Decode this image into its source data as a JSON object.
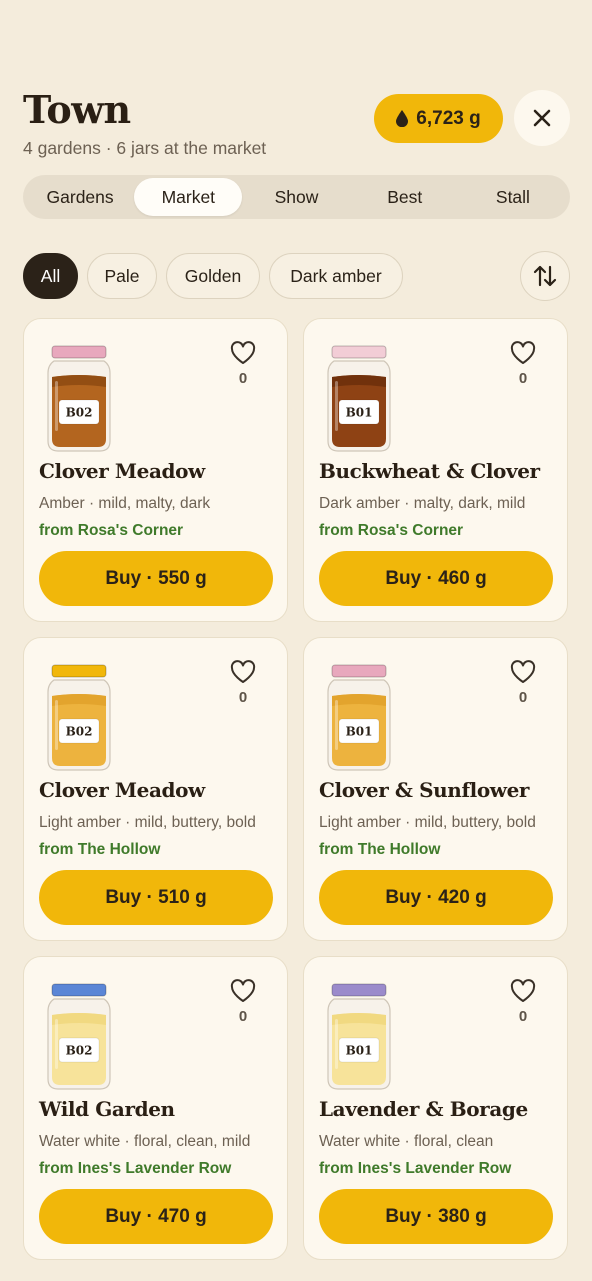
{
  "header": {
    "title": "Town",
    "subtitle": "4 gardens · 6 jars at the market",
    "balance": "6,723 g"
  },
  "tabs": [
    {
      "label": "Gardens",
      "active": false
    },
    {
      "label": "Market",
      "active": true
    },
    {
      "label": "Show",
      "active": false
    },
    {
      "label": "Best",
      "active": false
    },
    {
      "label": "Stall",
      "active": false
    }
  ],
  "filters": [
    {
      "label": "All",
      "active": true
    },
    {
      "label": "Pale",
      "active": false
    },
    {
      "label": "Golden",
      "active": false
    },
    {
      "label": "Dark amber",
      "active": false
    }
  ],
  "cards": [
    {
      "code": "B02",
      "name": "Clover Meadow",
      "desc": "Amber · mild, malty, dark",
      "from": "from Rosa's Corner",
      "favs": "0",
      "buy": "Buy · 550 g",
      "lid": "#e8a8bd",
      "honey": "#b3651f",
      "honeyTop": "#8d4a12"
    },
    {
      "code": "B01",
      "name": "Buckwheat & Clover",
      "desc": "Dark amber · malty, dark, mild",
      "from": "from Rosa's Corner",
      "favs": "0",
      "buy": "Buy · 460 g",
      "lid": "#f2cdd6",
      "honey": "#8e4214",
      "honeyTop": "#6c2e0b"
    },
    {
      "code": "B02",
      "name": "Clover Meadow",
      "desc": "Light amber · mild, buttery, bold",
      "from": "from The Hollow",
      "favs": "0",
      "buy": "Buy · 510 g",
      "lid": "#f1b70a",
      "honey": "#edb33e",
      "honeyTop": "#e0a12a"
    },
    {
      "code": "B01",
      "name": "Clover & Sunflower",
      "desc": "Light amber · mild, buttery, bold",
      "from": "from The Hollow",
      "favs": "0",
      "buy": "Buy · 420 g",
      "lid": "#e8a8bd",
      "honey": "#edb33e",
      "honeyTop": "#e0a12a"
    },
    {
      "code": "B02",
      "name": "Wild Garden",
      "desc": "Water white · floral, clean, mild",
      "from": "from Ines's Lavender Row",
      "favs": "0",
      "buy": "Buy · 470 g",
      "lid": "#5b86d6",
      "honey": "#f7e39a",
      "honeyTop": "#f0d77c"
    },
    {
      "code": "B01",
      "name": "Lavender & Borage",
      "desc": "Water white · floral, clean",
      "from": "from Ines's Lavender Row",
      "favs": "0",
      "buy": "Buy · 380 g",
      "lid": "#9b8bcb",
      "honey": "#f7e39a",
      "honeyTop": "#f0d77c"
    }
  ],
  "icons": {
    "balance": "drop-icon",
    "close": "close-icon",
    "sort": "sort-arrows-icon",
    "favorite": "heart-icon"
  }
}
